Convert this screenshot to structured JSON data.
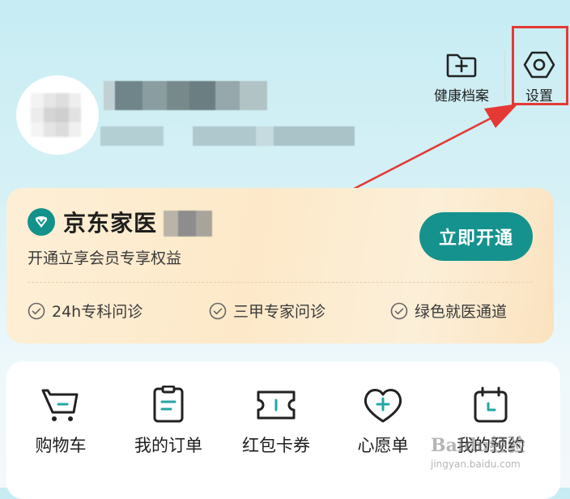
{
  "header": {
    "health_record_label": "健康档案",
    "settings_label": "设置",
    "health_record_icon": "folder-plus-icon",
    "settings_icon": "hexagon-gear-icon"
  },
  "vip": {
    "title": "京东家医",
    "subtitle": "开通立享会员专享权益",
    "button_label": "立即开通",
    "benefits": [
      "24h专科问诊",
      "三甲专家问诊",
      "绿色就医通道"
    ],
    "accent_color": "#16928e"
  },
  "menu": {
    "items": [
      {
        "label": "购物车",
        "icon": "shopping-cart-icon"
      },
      {
        "label": "我的订单",
        "icon": "clipboard-order-icon"
      },
      {
        "label": "红包卡券",
        "icon": "ticket-coupon-icon"
      },
      {
        "label": "心愿单",
        "icon": "heart-plus-icon"
      },
      {
        "label": "我的预约",
        "icon": "calendar-clock-icon"
      }
    ]
  },
  "watermark": {
    "brand": "Baidu经验",
    "url": "jingyan.baidu.com"
  }
}
